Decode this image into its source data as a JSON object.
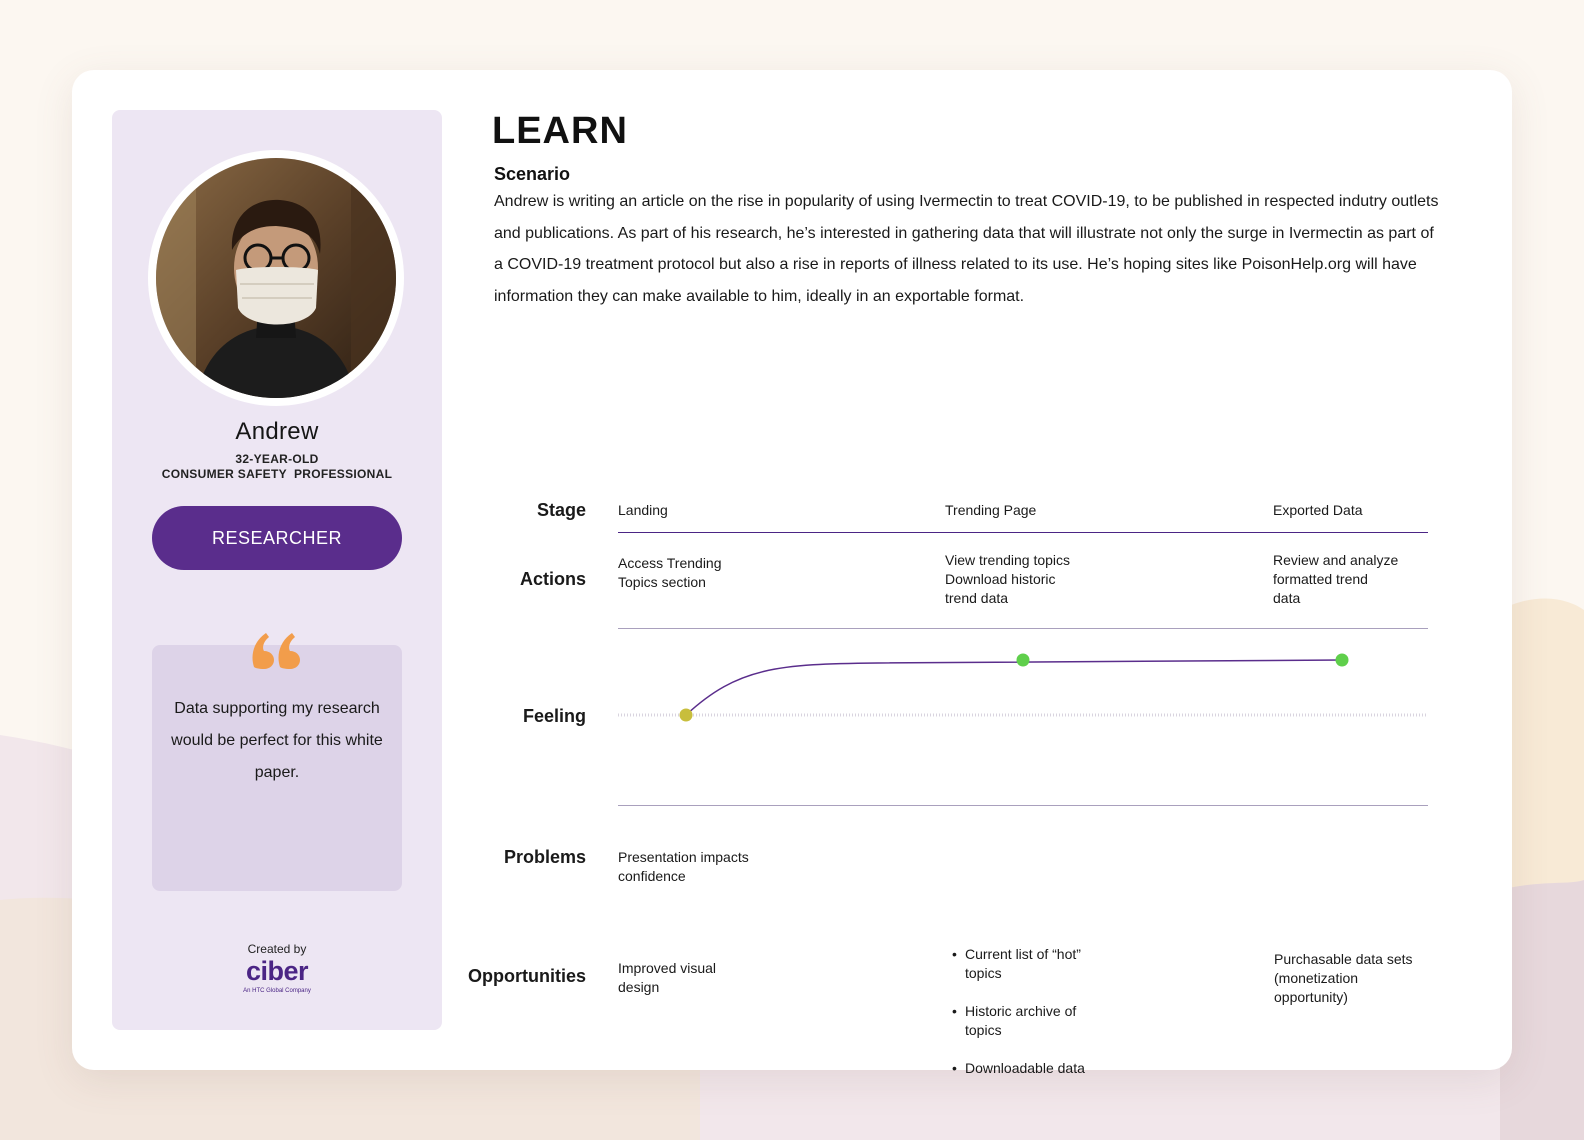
{
  "persona": {
    "name": "Andrew",
    "age": "32-YEAR-OLD",
    "occupation": "CONSUMER SAFETY  PROFESSIONAL",
    "role_button": "RESEARCHER",
    "quote": "Data supporting my research would be perfect for this white paper.",
    "credit_label": "Created by",
    "logo_text": "ciber",
    "logo_tagline": "An HTC Global Company"
  },
  "page": {
    "title": "LEARN",
    "scenario_label": "Scenario",
    "scenario_text": "Andrew is writing an article on the rise in popularity of using Ivermectin to treat COVID-19, to be published in respected indutry outlets and publications. As part of his research, he’s interested in gathering data that will illustrate not only the surge in Ivermectin as part of a COVID-19 treatment protocol but also a rise in reports of illness related to its use. He’s hoping sites like PoisonHelp.org will have information they can make available to him, ideally in an exportable format."
  },
  "journey": {
    "labels": {
      "stage": "Stage",
      "actions": "Actions",
      "feeling": "Feeling",
      "problems": "Problems",
      "opportunities": "Opportunities"
    },
    "stages": [
      "Landing",
      "Trending Page",
      "Exported Data"
    ],
    "actions": [
      "Access Trending\nTopics section",
      "View trending topics\nDownload historic\ntrend data",
      "Review and analyze\nformatted trend\ndata"
    ],
    "problems": [
      "Presentation impacts\nconfidence",
      "",
      ""
    ],
    "opportunities": {
      "landing": "Improved visual\ndesign",
      "trending": [
        "Current list of “hot”\ntopics",
        "Historic archive of\ntopics",
        "Downloadable data"
      ],
      "exported": "Purchasable data sets\n(monetization\nopportunity)"
    },
    "feeling_points": [
      {
        "stage": "Landing",
        "level": 0,
        "color": "#c8be3c"
      },
      {
        "stage": "Trending Page",
        "level": 1,
        "color": "#5fcf4b"
      },
      {
        "stage": "Exported Data",
        "level": 1,
        "color": "#5fcf4b"
      }
    ]
  },
  "colors": {
    "accent": "#5a2d8c",
    "panel": "#ede6f3",
    "quote_mark": "#f29d4b",
    "neutral_dot": "#c8be3c",
    "positive_dot": "#5fcf4b"
  }
}
